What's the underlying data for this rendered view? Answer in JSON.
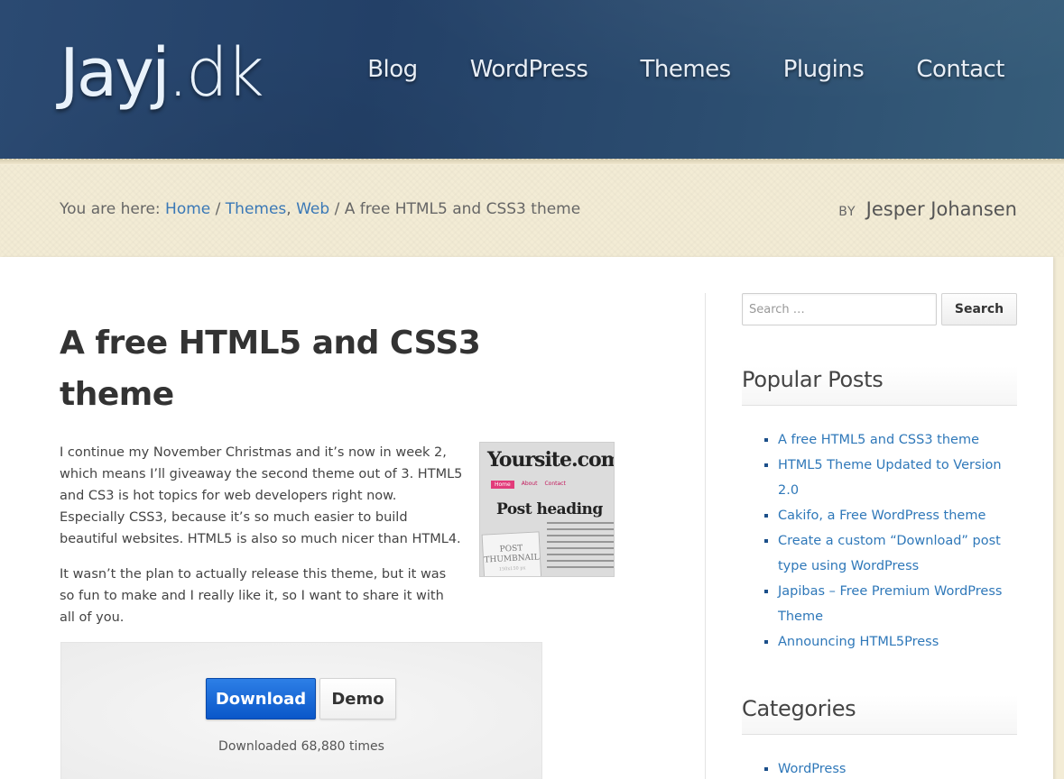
{
  "header": {
    "logo_main": "Jayj",
    "logo_tld": ".dk",
    "nav": [
      "Blog",
      "WordPress",
      "Themes",
      "Plugins",
      "Contact"
    ]
  },
  "breadcrumb": {
    "prefix": "You are here:",
    "home": "Home",
    "sep": "/",
    "cat1": "Themes",
    "cat_sep": ",",
    "cat2": "Web",
    "current": "A free HTML5 and CSS3 theme"
  },
  "byline": {
    "by": "BY",
    "author": "Jesper Johansen"
  },
  "post": {
    "title": "A free HTML5 and CSS3 theme",
    "p1": "I continue my November Christmas and it’s now in week 2, which means I’ll giveaway the second theme out of 3. HTML5 and CS3 is hot topics for web developers right now. Especially CSS3, because it’s so much easier to build beautiful websites. HTML5 is also so much nicer than HTML4.",
    "p2": "It wasn’t the plan to actually release this theme, but it was so fun to make and I really like it, so I want to share it with all of you.",
    "download_label": "Download",
    "demo_label": "Demo",
    "download_count": "Downloaded 68,880 times"
  },
  "thumbnail": {
    "site": "Yoursite.com",
    "nav": [
      "Home",
      "About",
      "Contact"
    ],
    "heading": "Post heading",
    "box": "POST THUMBNAIL",
    "box_size": "150x150 px"
  },
  "sidebar": {
    "search_placeholder": "Search …",
    "search_button": "Search",
    "popular_title": "Popular Posts",
    "popular": [
      "A free HTML5 and CSS3 theme",
      "HTML5 Theme Updated to Version 2.0",
      "Cakifo, a Free WordPress theme",
      "Create a custom “Download” post type using WordPress",
      "Japibas – Free Premium WordPress Theme",
      "Announcing HTML5Press"
    ],
    "categories_title": "Categories",
    "categories": [
      "WordPress"
    ]
  },
  "colors": {
    "header": "#234067",
    "link": "#2f78b9",
    "download_button": "#0a57c9",
    "band": "#f3ecd5"
  }
}
